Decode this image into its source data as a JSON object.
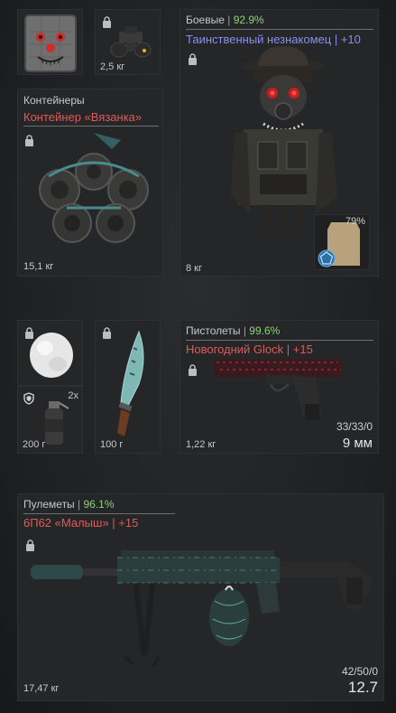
{
  "slots": {
    "mask": {},
    "nvg": {
      "weight": "2,5 кг"
    },
    "container": {
      "category": "Контейнеры",
      "name": "Контейнер «Вязанка»",
      "weight": "15,1 кг"
    },
    "armor": {
      "category": "Боевые",
      "percent": "92.9%",
      "name": "Таинственный незнакомец",
      "bonus": "+10",
      "weight": "8 кг",
      "plate_percent": "79%"
    },
    "snowball": {},
    "grenade": {
      "count": "2x",
      "weight": "200 г"
    },
    "knife": {
      "weight": "100 г"
    },
    "pistol": {
      "category": "Пистолеты",
      "percent": "99.6%",
      "name": "Новогодний Glock",
      "bonus": "+15",
      "weight": "1,22 кг",
      "ammo": "33/33/0",
      "caliber": "9 мм"
    },
    "mg": {
      "category": "Пулеметы",
      "percent": "96.1%",
      "name": "6П62 «Малыш»",
      "bonus": "+15",
      "weight": "17,47 кг",
      "ammo": "42/50/0",
      "caliber": "12.7"
    }
  },
  "colors": {
    "percent_green": "#8fd17a",
    "name_red": "#e05a5a",
    "name_blue": "#8a8ef0"
  },
  "icons": [
    "lock-icon",
    "shield-icon",
    "pentagon-plate-icon"
  ]
}
